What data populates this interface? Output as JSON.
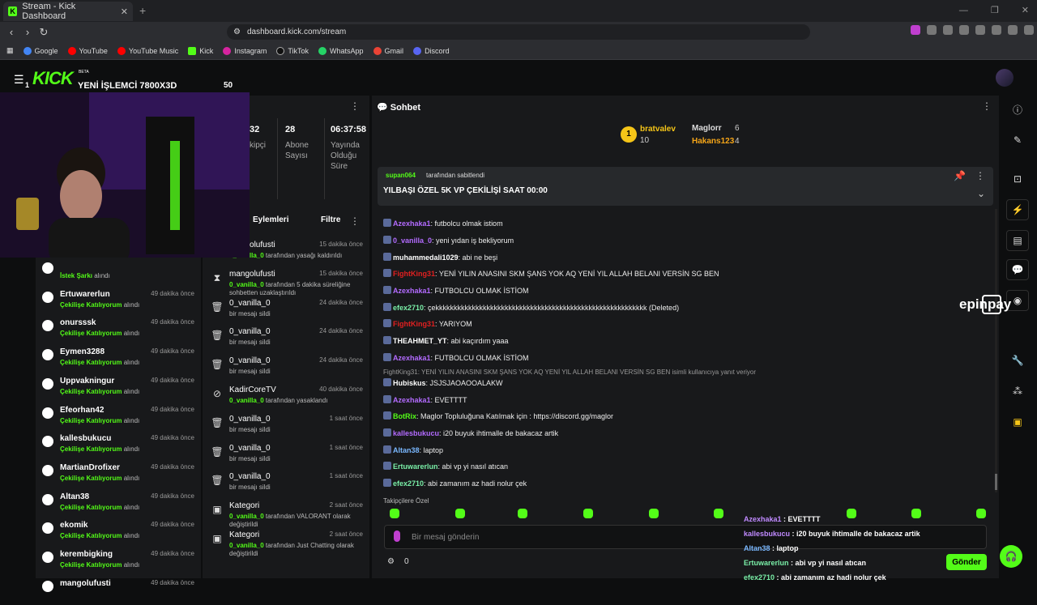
{
  "browser": {
    "tab_title": "Stream - Kick Dashboard",
    "tab_close": "✕",
    "new_tab": "+",
    "url": "dashboard.kick.com/stream",
    "bookmarks": [
      "Google",
      "YouTube",
      "YouTube Music",
      "Kick",
      "Instagram",
      "TikTok",
      "WhatsApp",
      "Gmail",
      "Discord"
    ],
    "win_minimize": "—",
    "win_restore": "❐",
    "win_close": "✕"
  },
  "overlay": {
    "logo": "KICK",
    "beta": "BETA",
    "title": "YENİ İŞLEMCİ 7800X3D",
    "left_num": "1",
    "right_num": "50"
  },
  "stats": {
    "items": [
      {
        "value": "32",
        "label": "kipçi"
      },
      {
        "value": "28",
        "label": "Abone Sayısı"
      },
      {
        "value": "06:37:58",
        "label": "Yayında Olduğu Süre"
      }
    ]
  },
  "left_list": [
    {
      "name": "",
      "sub_a": "İstek Şarkı",
      "sub_b": "alındı",
      "time": ""
    },
    {
      "name": "Ertuwarerlun",
      "sub_a": "Çekilişe Katılıyorum",
      "sub_b": "alındı",
      "time": "49 dakika önce"
    },
    {
      "name": "onursssk",
      "sub_a": "Çekilişe Katılıyorum",
      "sub_b": "alındı",
      "time": "49 dakika önce"
    },
    {
      "name": "Eymen3288",
      "sub_a": "Çekilişe Katılıyorum",
      "sub_b": "alındı",
      "time": "49 dakika önce"
    },
    {
      "name": "Uppvakningur",
      "sub_a": "Çekilişe Katılıyorum",
      "sub_b": "alındı",
      "time": "49 dakika önce"
    },
    {
      "name": "Efeorhan42",
      "sub_a": "Çekilişe Katılıyorum",
      "sub_b": "alındı",
      "time": "49 dakika önce"
    },
    {
      "name": "kallesbukucu",
      "sub_a": "Çekilişe Katılıyorum",
      "sub_b": "alındı",
      "time": "49 dakika önce"
    },
    {
      "name": "MartianDrofixer",
      "sub_a": "Çekilişe Katılıyorum",
      "sub_b": "alındı",
      "time": "49 dakika önce"
    },
    {
      "name": "Altan38",
      "sub_a": "Çekilişe Katılıyorum",
      "sub_b": "alındı",
      "time": "49 dakika önce"
    },
    {
      "name": "ekomik",
      "sub_a": "Çekilişe Katılıyorum",
      "sub_b": "alındı",
      "time": "49 dakika önce"
    },
    {
      "name": "kerembigking",
      "sub_a": "Çekilişe Katılıyorum",
      "sub_b": "alındı",
      "time": "49 dakika önce"
    },
    {
      "name": "mangolufusti",
      "sub_a": "",
      "sub_b": "",
      "time": "49 dakika önce"
    }
  ],
  "activity": {
    "title": "Eylemleri",
    "filter": "Filtre",
    "items": [
      {
        "name": "mangolufusti",
        "time": "15 dakika önce",
        "sub_a": "0_vanilla_0",
        "sub_b": "tarafından yasağı kaldırıldı"
      },
      {
        "name": "mangolufusti",
        "time": "15 dakika önce",
        "sub_a": "0_vanilla_0",
        "sub_b": "tarafından 5 dakika süreliğine sohbetten uzaklaştırıldı"
      },
      {
        "name": "0_vanilla_0",
        "time": "24 dakika önce",
        "sub_a": "",
        "sub_b": "bir mesajı sildi"
      },
      {
        "name": "0_vanilla_0",
        "time": "24 dakika önce",
        "sub_a": "",
        "sub_b": "bir mesajı sildi"
      },
      {
        "name": "0_vanilla_0",
        "time": "24 dakika önce",
        "sub_a": "",
        "sub_b": "bir mesajı sildi"
      },
      {
        "name": "KadirCoreTV",
        "time": "40 dakika önce",
        "sub_a": "0_vanilla_0",
        "sub_b": "tarafından yasaklandı"
      },
      {
        "name": "0_vanilla_0",
        "time": "1 saat önce",
        "sub_a": "",
        "sub_b": "bir mesajı sildi"
      },
      {
        "name": "0_vanilla_0",
        "time": "1 saat önce",
        "sub_a": "",
        "sub_b": "bir mesajı sildi"
      },
      {
        "name": "0_vanilla_0",
        "time": "1 saat önce",
        "sub_a": "",
        "sub_b": "bir mesajı sildi"
      },
      {
        "name": "Kategori",
        "time": "2 saat önce",
        "sub_a": "0_vanilla_0",
        "sub_b": "tarafından VALORANT olarak değiştirildi"
      },
      {
        "name": "Kategori",
        "time": "2 saat önce",
        "sub_a": "0_vanilla_0",
        "sub_b": "tarafından Just Chatting olarak değiştirildi"
      }
    ]
  },
  "chat": {
    "title": "Sohbet",
    "leaderboard": {
      "first_name": "bratvalev",
      "first_count": "10",
      "second_name": "Maglorr",
      "second_count": "6",
      "third_name": "Hakans123",
      "third_count": "4",
      "rank": "1"
    },
    "pinned": {
      "by_user": "supan064",
      "by_text": "tarafından sabitlendi",
      "text": "YILBAŞI ÖZEL 5K VP ÇEKİLİŞİ SAAT 00:00"
    },
    "messages": [
      {
        "user": "Azexhaka1",
        "color": "#b36bff",
        "text": "futbolcu olmak istiom"
      },
      {
        "user": "0_vanilla_0",
        "color": "#b36bff",
        "text": "yeni yıdan iş bekliyorum"
      },
      {
        "user": "muhammedali1029",
        "color": "#ffffff",
        "text": "abi ne beşi"
      },
      {
        "user": "FightKing31",
        "color": "#e02020",
        "text": "YENİ YILIN ANASINI SKM ŞANS YOK AQ YENİ YIL ALLAH BELANI VERSİN SG BEN"
      },
      {
        "user": "Azexhaka1",
        "color": "#b36bff",
        "text": "FUTBOLCU OLMAK İSTİOM"
      },
      {
        "user": "efex2710",
        "color": "#7af0a8",
        "text": "çekkkkkkkkkkkkkkkkkkkkkkkkkkkkkkkkkkkkkkkkkkkkkkkkkkkkkkkkkk (Deleted)"
      },
      {
        "user": "FightKing31",
        "color": "#e02020",
        "text": "YARIYOM"
      },
      {
        "user": "THEAHMET_YT",
        "color": "#ffffff",
        "text": "abi kaçırdım yaaa"
      },
      {
        "user": "Azexhaka1",
        "color": "#b36bff",
        "text": "FUTBOLCU OLMAK İSTİOM"
      },
      {
        "user": "Hubiskus",
        "color": "#ffffff",
        "text": "JSJSJAOAOOALAKW"
      },
      {
        "user": "Azexhaka1",
        "color": "#b36bff",
        "text": "EVETTTT"
      },
      {
        "user": "BotRix",
        "color": "#53fc18",
        "text": "Maglor Topluluğuna Katılmak için : https://discord.gg/maglor"
      },
      {
        "user": "kallesbukucu",
        "color": "#b36bff",
        "text": "i20 buyuk ihtimalle de bakacaz artik"
      },
      {
        "user": "Altan38",
        "color": "#7ab8ff",
        "text": "laptop"
      },
      {
        "user": "Ertuwarerlun",
        "color": "#7af0a8",
        "text": "abi vp yi nasıl atıcan"
      },
      {
        "user": "efex2710",
        "color": "#7af0a8",
        "text": "abi zamanım az hadi nolur çek"
      }
    ],
    "reply_note": "FightKing31: YENİ YILIN ANASINI SKM ŞANS YOK AQ YENİ YIL ALLAH BELANI VERSİN SG BEN isimli kullanıcıya yanıt veriyor",
    "followers_only": "Takipçilere Özel",
    "input_placeholder": "Bir mesaj gönderin",
    "points": "0",
    "send": "Gönder"
  },
  "overlay_chat": [
    {
      "user": "Azexhaka1",
      "text": "EVETTTT"
    },
    {
      "user": "kallesbukucu",
      "text": "i20 buyuk ihtimalle de bakacaz artik"
    },
    {
      "user": "Altan38",
      "text": "laptop"
    },
    {
      "user": "Ertuwarerlun",
      "text": "abi vp yi nasıl atıcan"
    },
    {
      "user": "efex2710",
      "text": "abi zamanım az hadi nolur çek"
    }
  ],
  "sponsor": "epinpay",
  "colors": {
    "accent": "#53fc18",
    "panel": "#18191b",
    "bg": "#0d0e0f"
  }
}
